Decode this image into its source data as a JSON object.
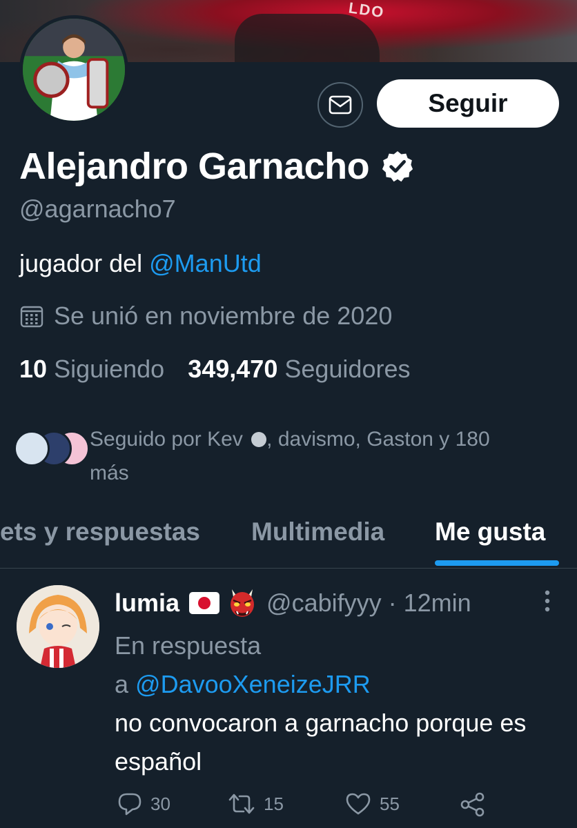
{
  "banner": {
    "text": "LDO"
  },
  "profile": {
    "name": "Alejandro Garnacho",
    "handle": "@agarnacho7",
    "bio_prefix": "jugador del ",
    "bio_mention": "@ManUtd",
    "joined": "Se unió en noviembre de 2020",
    "following_count": "10",
    "following_label": "Siguiendo",
    "followers_count": "349,470",
    "followers_label": "Seguidores",
    "followed_by_prefix": "Seguido por Kev",
    "followed_by_suffix": ", davismo, Gaston y 180 más"
  },
  "buttons": {
    "follow_label": "Seguir"
  },
  "icons": {
    "message": "mail-icon",
    "verified": "verified-badge-icon",
    "calendar": "calendar-icon",
    "more": "more-vertical-icon",
    "reply": "reply-icon",
    "retweet": "retweet-icon",
    "like": "heart-icon",
    "share": "share-icon"
  },
  "tabs": [
    {
      "label": "ets y respuestas"
    },
    {
      "label": "Multimedia"
    },
    {
      "label": "Me gusta"
    }
  ],
  "tweet": {
    "name": "lumia",
    "handle": "@cabifyyy",
    "time_sep": " · ",
    "time": "12min",
    "reply_prefix": "En respuesta",
    "reply_a": "a ",
    "reply_mention": "@DavooXeneizeJRR",
    "text": "no convocaron a garnacho porque es español",
    "replies": "30",
    "retweets": "15",
    "likes": "55"
  },
  "colors": {
    "background": "#15202b",
    "accent": "#1d9bf0",
    "secondary_text": "#8b98a5",
    "border": "#38444d"
  }
}
